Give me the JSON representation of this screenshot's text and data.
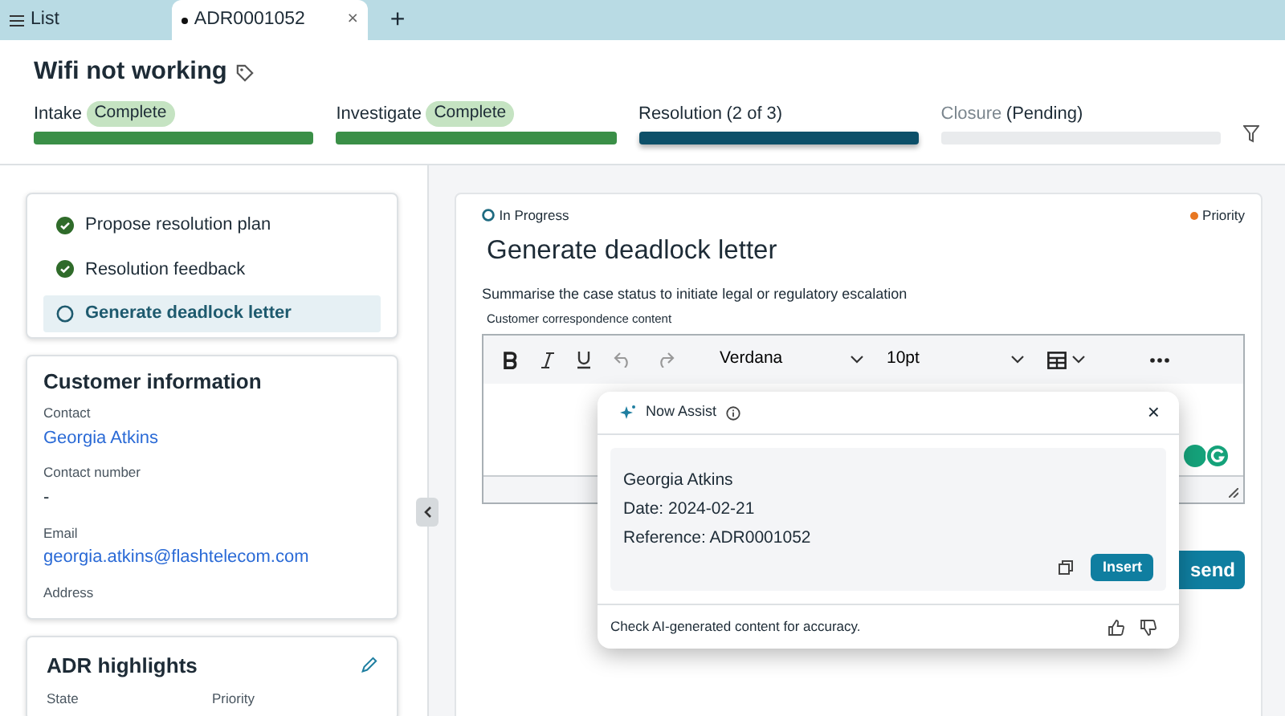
{
  "tabs": [
    {
      "label": "List",
      "kind": "list",
      "selected": false
    },
    {
      "label": "ADR0001052",
      "kind": "record",
      "close": "×",
      "selected": true
    }
  ],
  "add_tab": "+",
  "title": "Wifi not working",
  "stages": [
    {
      "label": "Intake",
      "badge": "Complete",
      "kind": "complete"
    },
    {
      "label": "Investigate",
      "badge": "Complete",
      "kind": "complete"
    },
    {
      "label": "Resolution",
      "detail": "(2 of 3)",
      "kind": "active"
    },
    {
      "label": "Closure",
      "detail": "(Pending)",
      "kind": "pending"
    }
  ],
  "steps": [
    {
      "label": "Propose resolution plan",
      "done": true,
      "selected": false
    },
    {
      "label": "Resolution feedback",
      "done": true,
      "selected": false
    },
    {
      "label": "Generate deadlock letter",
      "done": false,
      "selected": true
    }
  ],
  "customer": {
    "heading": "Customer information",
    "fields": [
      {
        "label": "Contact",
        "value": "Georgia Atkins",
        "kind": "link"
      },
      {
        "label": "Contact number",
        "value": "-",
        "kind": "text"
      },
      {
        "label": "Email",
        "value": "georgia.atkins@flashtelecom.com",
        "kind": "link"
      },
      {
        "label": "Address"
      }
    ]
  },
  "highlights": {
    "heading": "ADR highlights",
    "columns": [
      "State",
      "Priority"
    ]
  },
  "task": {
    "state": "In Progress",
    "priority": "Priority",
    "title": "Generate deadlock letter",
    "instruction": "Summarise the case status to initiate legal or regulatory escalation",
    "field_label": "Customer correspondence content",
    "font": "Verdana",
    "size": "10pt",
    "send_button": "send"
  },
  "assist": {
    "title": "Now Assist",
    "close": "×",
    "lines": [
      "Georgia Atkins",
      "Date: 2024-02-21",
      "Reference: ADR0001052"
    ],
    "insert": "Insert",
    "footer": "Check AI-generated content for accuracy."
  }
}
